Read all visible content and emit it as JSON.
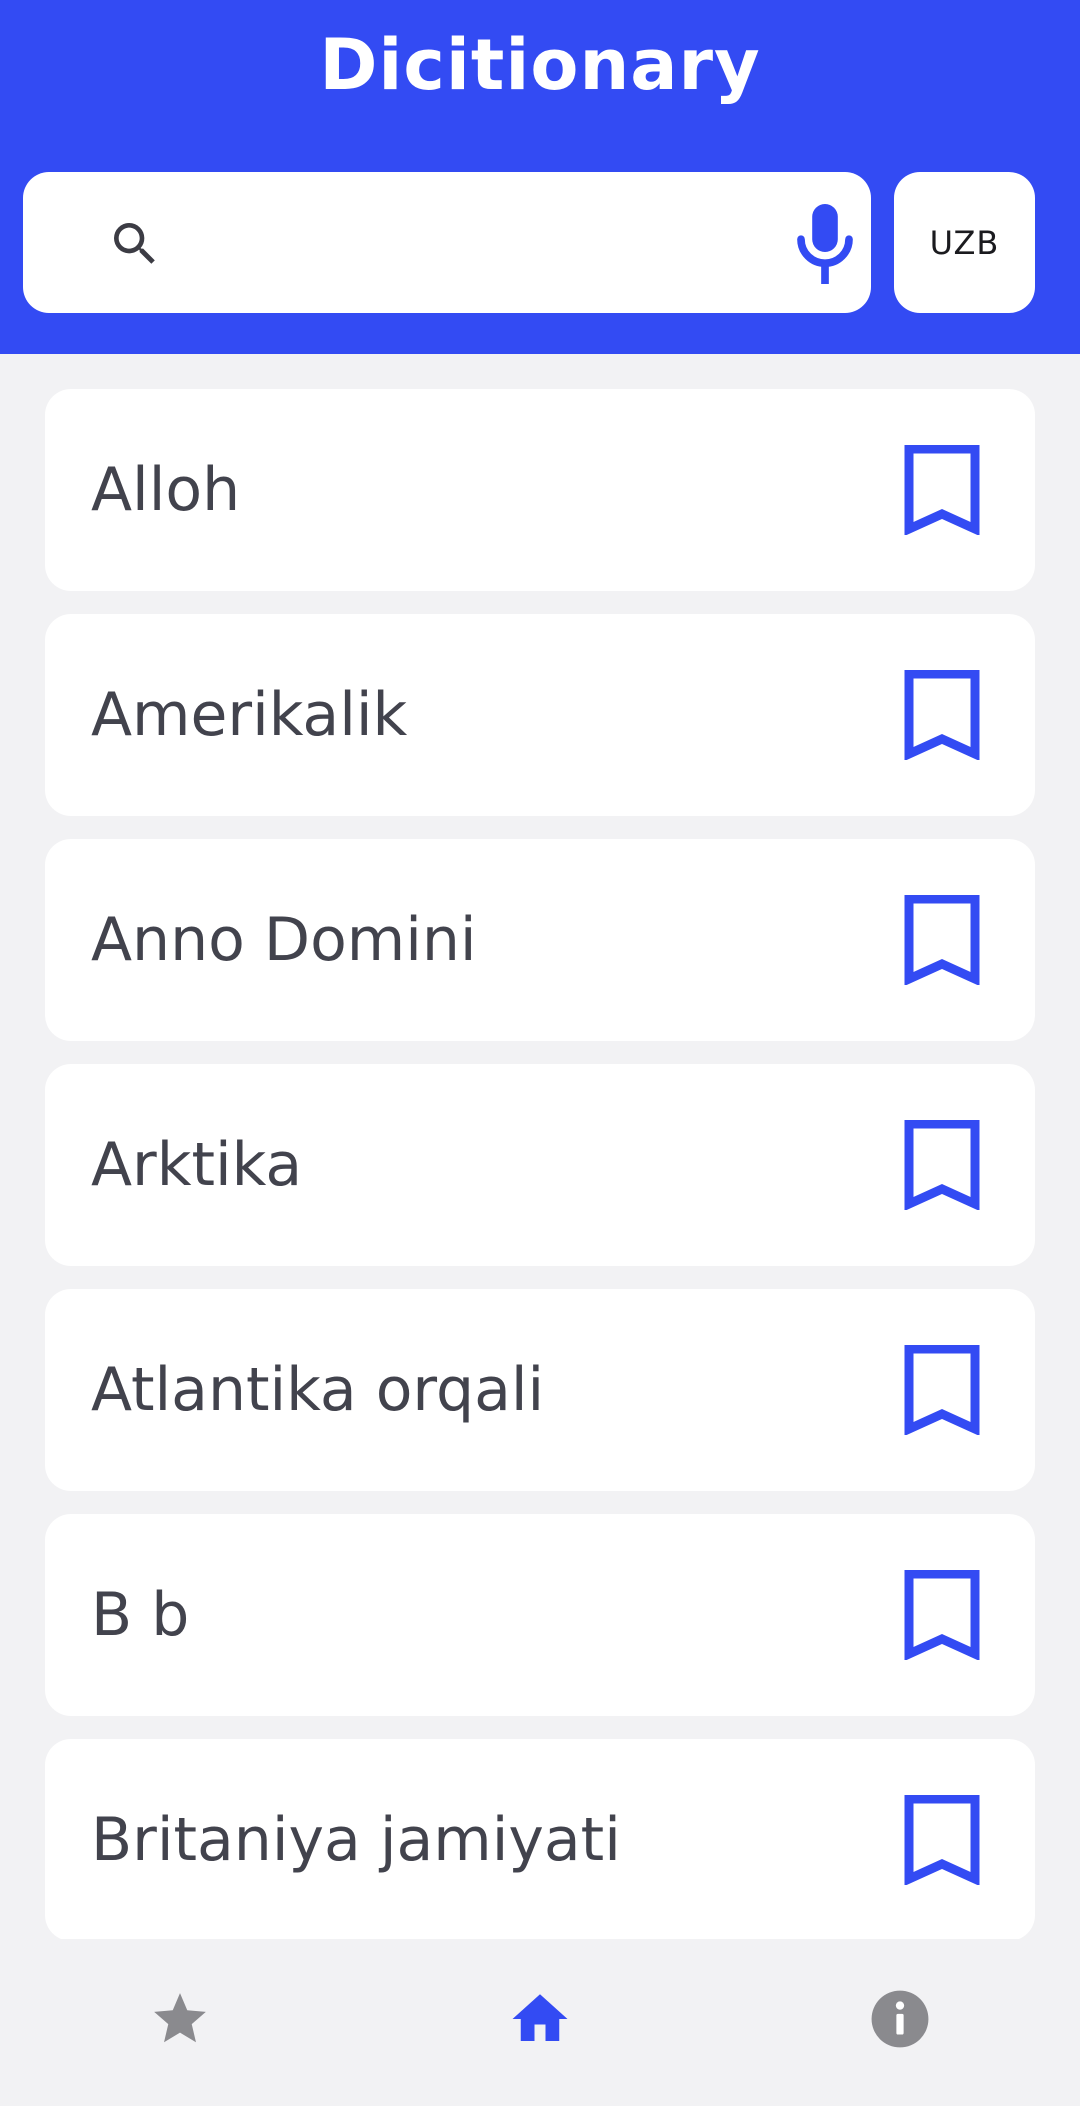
{
  "app": {
    "title": "Dicitionary"
  },
  "search": {
    "value": "",
    "placeholder": "",
    "icon": "search-icon",
    "voice_icon": "microphone-icon"
  },
  "language_button": {
    "label": "UZB"
  },
  "words": [
    {
      "label": "Alloh",
      "bookmark_icon": "bookmark-outline-icon"
    },
    {
      "label": "Amerikalik",
      "bookmark_icon": "bookmark-outline-icon"
    },
    {
      "label": "Anno Domini",
      "bookmark_icon": "bookmark-outline-icon"
    },
    {
      "label": "Arktika",
      "bookmark_icon": "bookmark-outline-icon"
    },
    {
      "label": "Atlantika orqali",
      "bookmark_icon": "bookmark-outline-icon"
    },
    {
      "label": "B b",
      "bookmark_icon": "bookmark-outline-icon"
    },
    {
      "label": "Britaniya jamiyati",
      "bookmark_icon": "bookmark-outline-icon"
    }
  ],
  "bottom_nav": {
    "items": [
      {
        "icon": "star-icon",
        "active": false
      },
      {
        "icon": "home-icon",
        "active": true
      },
      {
        "icon": "info-icon",
        "active": false
      }
    ]
  },
  "colors": {
    "primary": "#334bf3",
    "background": "#f2f2f4",
    "card": "#ffffff",
    "text": "#42434d",
    "inactive_icon": "#8a8a8e",
    "search_icon": "#3c3c44"
  }
}
